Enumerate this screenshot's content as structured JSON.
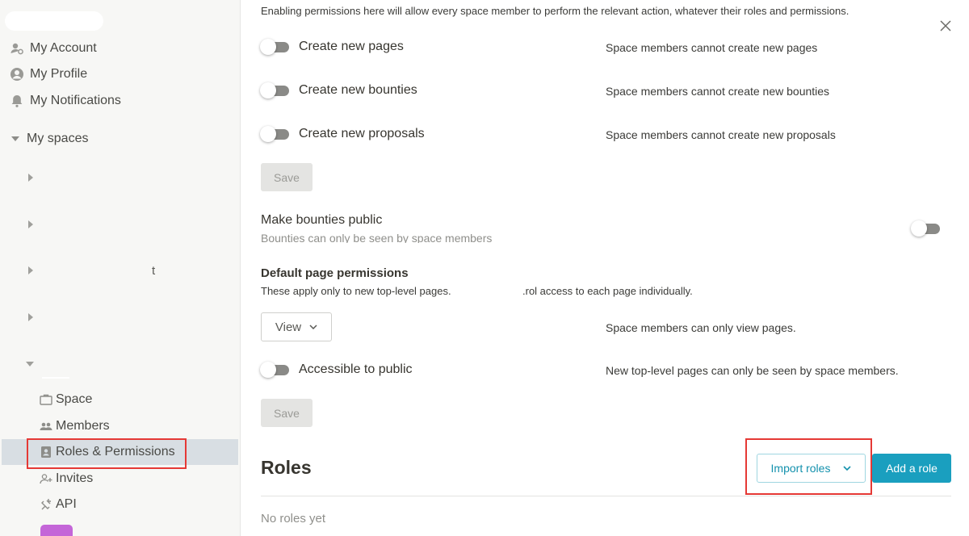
{
  "sidebar": {
    "account_label": "My Account",
    "profile_label": "My Profile",
    "notifications_label": "My Notifications",
    "spaces_label": "My spaces",
    "stray_char": "t",
    "sub_items": {
      "space": "Space",
      "members": "Members",
      "roles": "Roles & Permissions",
      "invites": "Invites",
      "api": "API"
    }
  },
  "main": {
    "intro": "Enabling permissions here will allow every space member to perform the relevant action, whatever their roles and permissions.",
    "permissions": [
      {
        "label": "Create new pages",
        "desc": "Space members cannot create new pages"
      },
      {
        "label": "Create new bounties",
        "desc": "Space members cannot create new bounties"
      },
      {
        "label": "Create new proposals",
        "desc": "Space members cannot create new proposals"
      }
    ],
    "save_label": "Save",
    "bounties_public": {
      "title": "Make bounties public",
      "desc": "Bounties can only be seen by space members"
    },
    "default_perms": {
      "title": "Default page permissions",
      "desc_left": "These apply only to new top-level pages.",
      "desc_right": ".rol access to each page individually.",
      "select_value": "View",
      "select_desc": "Space members can only view pages.",
      "public_label": "Accessible to public",
      "public_desc": "New top-level pages can only be seen by space members."
    },
    "roles": {
      "title": "Roles",
      "import_label": "Import roles",
      "add_label": "Add a role",
      "empty": "No roles yet"
    }
  },
  "colors": {
    "accent": "#1a9fbf",
    "highlight": "#e53935",
    "avatar": "#c466d8"
  },
  "icons": [
    "account-icon",
    "profile-icon",
    "bell-icon",
    "briefcase-icon",
    "members-icon",
    "badge-icon",
    "invite-icon",
    "api-icon",
    "close-icon",
    "chevron-down-icon"
  ]
}
